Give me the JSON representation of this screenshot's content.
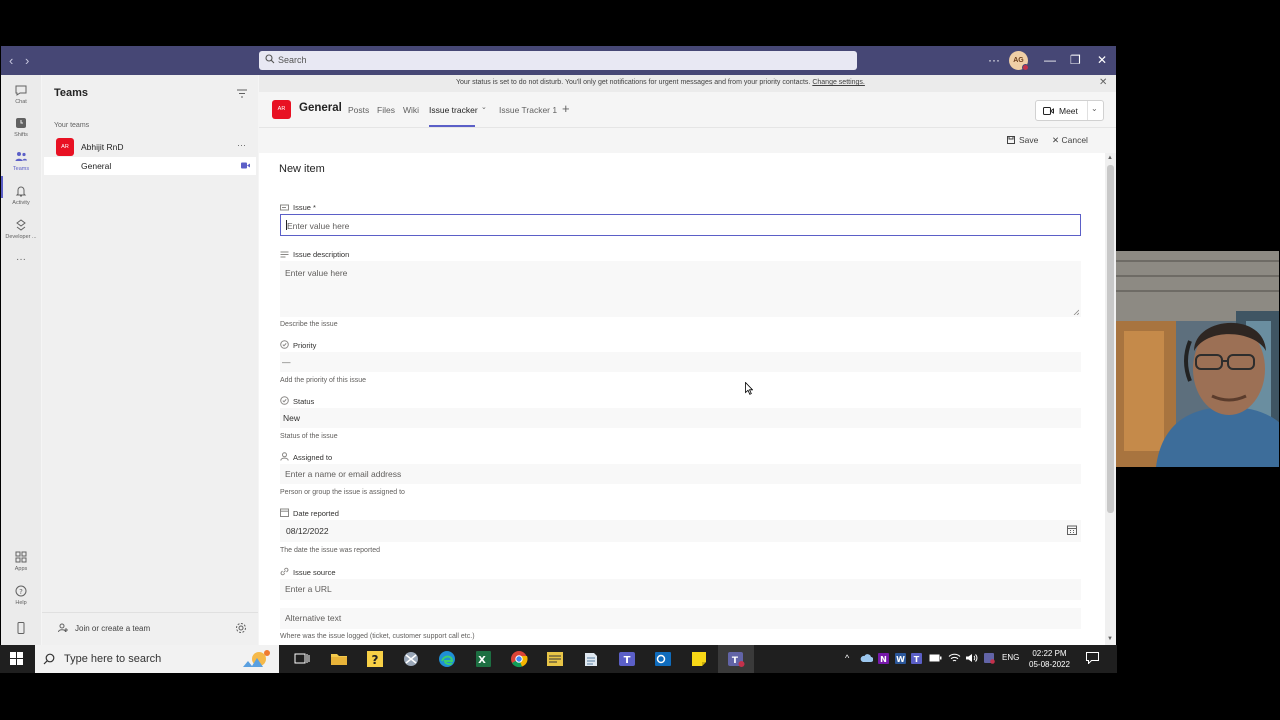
{
  "titlebar": {
    "search_placeholder": "Search",
    "more": "···",
    "user_initials": "AG",
    "minimize": "—",
    "maximize": "❐",
    "close": "✕"
  },
  "rail": {
    "items": [
      {
        "label": "Chat",
        "icon": "chat-icon"
      },
      {
        "label": "Shifts",
        "icon": "shifts-icon"
      },
      {
        "label": "Teams",
        "icon": "teams-icon"
      },
      {
        "label": "Activity",
        "icon": "bell-icon"
      },
      {
        "label": "Developer ...",
        "icon": "developer-icon"
      },
      {
        "label": "···",
        "icon": "more-icon"
      },
      {
        "label": "Apps",
        "icon": "apps-icon"
      },
      {
        "label": "Help",
        "icon": "help-icon"
      }
    ]
  },
  "panel": {
    "title": "Teams",
    "section": "Your teams",
    "team": {
      "initials": "AR",
      "name": "Abhijit RnD",
      "more": "···"
    },
    "channel": "General",
    "join": "Join or create a team"
  },
  "banner": {
    "text": "Your status is set to do not disturb. You'll only get notifications for urgent messages and from your priority contacts.",
    "link": "Change settings.",
    "close": "✕"
  },
  "channel_header": {
    "initials": "AR",
    "title": "General",
    "tabs": [
      "Posts",
      "Files",
      "Wiki",
      "Issue tracker",
      "Issue Tracker 1"
    ],
    "tab_chevron": "⌄",
    "add": "+",
    "meet": "Meet",
    "meet_chevron": "⌄"
  },
  "actions": {
    "save": "Save",
    "cancel": "✕  Cancel"
  },
  "form": {
    "title": "New item",
    "fields": {
      "issue": {
        "label": "Issue *",
        "placeholder": "Enter value here"
      },
      "description": {
        "label": "Issue description",
        "placeholder": "Enter value here",
        "help": "Describe the issue"
      },
      "priority": {
        "label": "Priority",
        "value": "—",
        "help": "Add the priority of this issue"
      },
      "status": {
        "label": "Status",
        "value": "New",
        "help": "Status of the issue"
      },
      "assigned": {
        "label": "Assigned to",
        "placeholder": "Enter a name or email address",
        "help": "Person or group the issue is assigned to"
      },
      "date": {
        "label": "Date reported",
        "value": "08/12/2022",
        "help": "The date the issue was reported"
      },
      "source": {
        "label": "Issue source",
        "placeholder": "Enter a URL",
        "alt_placeholder": "Alternative text",
        "help": "Where was the issue logged (ticket, customer support call etc.)"
      }
    }
  },
  "taskbar": {
    "search_placeholder": "Type here to search",
    "language": "ENG",
    "time": "02:22 PM",
    "date": "05-08-2022",
    "tray_chevron": "^"
  },
  "colors": {
    "titlebar": "#464775",
    "accent": "#5b5fc7",
    "team_avatar": "#e81123",
    "taskbar": "#1f1f1f"
  }
}
